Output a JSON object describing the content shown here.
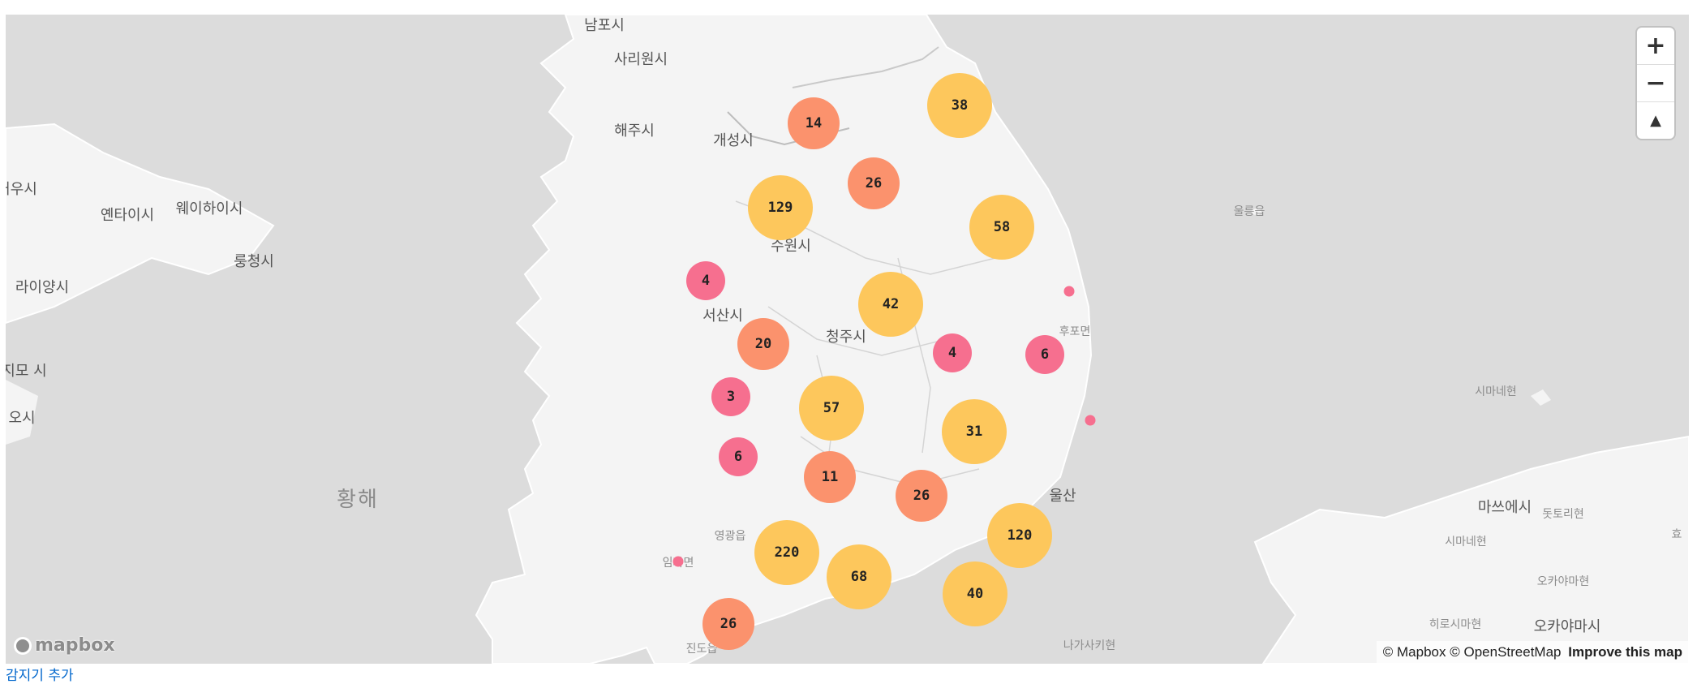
{
  "map": {
    "sea_label": "황해",
    "place_labels": [
      {
        "text": "남포시",
        "kind": "city"
      },
      {
        "text": "사리원시",
        "kind": "city"
      },
      {
        "text": "해주시",
        "kind": "city"
      },
      {
        "text": "개성시",
        "kind": "city"
      },
      {
        "text": "수원시",
        "kind": "city"
      },
      {
        "text": "서산시",
        "kind": "city"
      },
      {
        "text": "청주시",
        "kind": "city"
      },
      {
        "text": "울산",
        "kind": "city"
      },
      {
        "text": "후포면",
        "kind": "small"
      },
      {
        "text": "울릉읍",
        "kind": "small"
      },
      {
        "text": "영광읍",
        "kind": "small"
      },
      {
        "text": "임자면",
        "kind": "small"
      },
      {
        "text": "진도읍",
        "kind": "small"
      },
      {
        "text": "나가사키현",
        "kind": "small"
      },
      {
        "text": "커우시",
        "kind": "city"
      },
      {
        "text": "옌타이시",
        "kind": "city"
      },
      {
        "text": "웨이하이시",
        "kind": "city"
      },
      {
        "text": "룽청시",
        "kind": "city"
      },
      {
        "text": "라이양시",
        "kind": "city"
      },
      {
        "text": "지모 시",
        "kind": "city"
      },
      {
        "text": "오시",
        "kind": "city"
      },
      {
        "text": "시마네현",
        "kind": "small"
      },
      {
        "text": "마쓰에시",
        "kind": "city"
      },
      {
        "text": "돗토리현",
        "kind": "small"
      },
      {
        "text": "시마네현",
        "kind": "small"
      },
      {
        "text": "오카야마현",
        "kind": "small"
      },
      {
        "text": "히로시마현",
        "kind": "small"
      },
      {
        "text": "오카야마시",
        "kind": "city"
      },
      {
        "text": "효",
        "kind": "small"
      }
    ],
    "clusters": [
      {
        "count": "38",
        "tier": "large"
      },
      {
        "count": "14",
        "tier": "medium"
      },
      {
        "count": "26",
        "tier": "medium"
      },
      {
        "count": "129",
        "tier": "large"
      },
      {
        "count": "58",
        "tier": "large"
      },
      {
        "count": "4",
        "tier": "small"
      },
      {
        "count": "42",
        "tier": "large"
      },
      {
        "count": "20",
        "tier": "medium"
      },
      {
        "count": "4",
        "tier": "small"
      },
      {
        "count": "6",
        "tier": "small"
      },
      {
        "count": "3",
        "tier": "small"
      },
      {
        "count": "57",
        "tier": "large"
      },
      {
        "count": "31",
        "tier": "large"
      },
      {
        "count": "6",
        "tier": "small"
      },
      {
        "count": "11",
        "tier": "medium"
      },
      {
        "count": "26",
        "tier": "medium"
      },
      {
        "count": "120",
        "tier": "large"
      },
      {
        "count": "220",
        "tier": "large"
      },
      {
        "count": "68",
        "tier": "large"
      },
      {
        "count": "40",
        "tier": "large"
      },
      {
        "count": "26",
        "tier": "medium"
      }
    ],
    "single_points": 3,
    "colors": {
      "large": "#fdc75c",
      "medium": "#fb926d",
      "small": "#f66f8f",
      "point": "#f66f8f",
      "water": "#dcdcdc",
      "land": "#f4f4f4"
    },
    "controls": {
      "zoom_in": "+",
      "zoom_out": "−",
      "compass": "▲"
    },
    "attribution": {
      "mapbox": "© Mapbox",
      "osm": "© OpenStreetMap",
      "improve": "Improve this map"
    },
    "logo_text": "mapbox"
  },
  "below_link": "감지기 추가"
}
